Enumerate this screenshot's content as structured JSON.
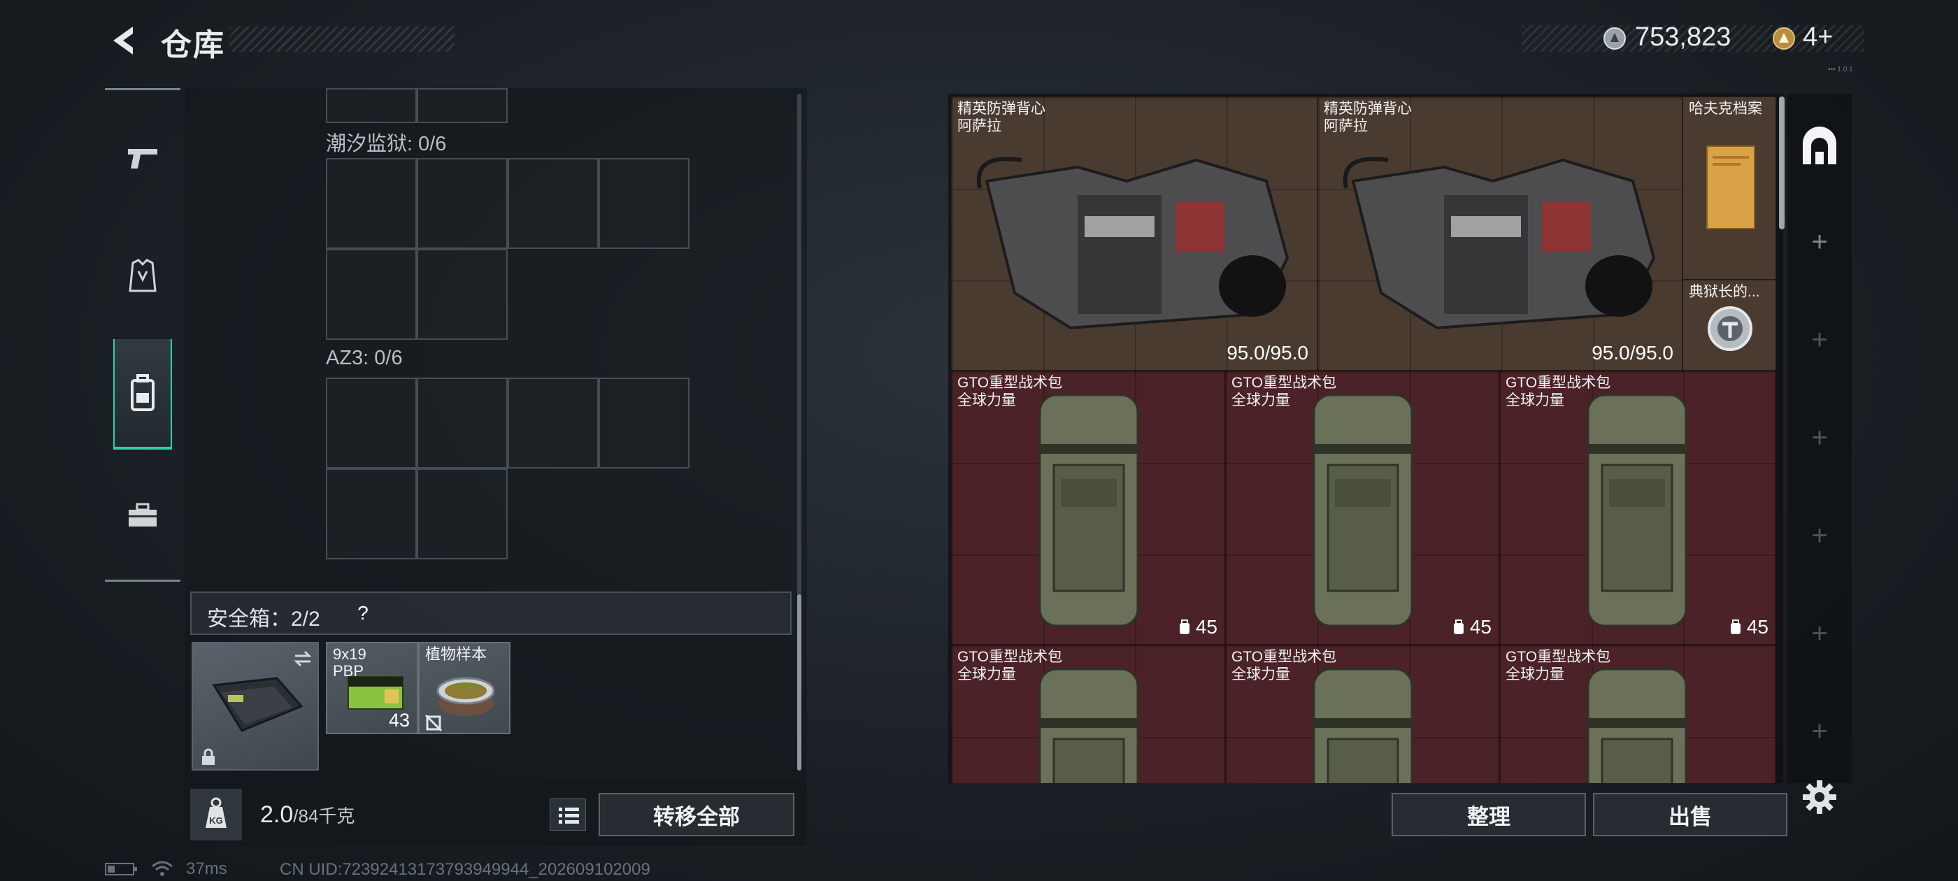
{
  "header": {
    "title": "仓库",
    "coin_value": "753,823",
    "premium_value": "4+",
    "version": "▪▪▪ 1.0.1"
  },
  "left": {
    "sections": [
      {
        "label": "潮汐监狱: 0/6"
      },
      {
        "label": "AZ3: 0/6"
      }
    ],
    "safebox": {
      "label": "安全箱：2/2",
      "help": "?"
    },
    "safebox_items": [
      {
        "name": "9x19\nPBP",
        "count": "43"
      },
      {
        "name": "植物样本",
        "count": ""
      }
    ],
    "weight": {
      "value": "2.0",
      "max": "/84千克",
      "kg_icon_text": "KG"
    },
    "transfer_all_label": "转移全部"
  },
  "stash": {
    "items": [
      {
        "name": "精英防弹背心\n阿萨拉",
        "durability": "95.0/95.0"
      },
      {
        "name": "精英防弹背心\n阿萨拉",
        "durability": "95.0/95.0"
      },
      {
        "name": "哈夫克档案"
      },
      {
        "name": "典狱长的..."
      },
      {
        "name": "GTO重型战术包\n全球力量",
        "capacity": "45"
      },
      {
        "name": "GTO重型战术包\n全球力量",
        "capacity": "45"
      },
      {
        "name": "GTO重型战术包\n全球力量",
        "capacity": "45"
      },
      {
        "name": "GTO重型战术包\n全球力量"
      },
      {
        "name": "GTO重型战术包\n全球力量"
      },
      {
        "name": "GTO重型战术包\n全球力量"
      }
    ],
    "sort_label": "整理",
    "sell_label": "出售"
  },
  "status": {
    "ping": "37ms",
    "uid": "CN UID:72392413173793949944_202609102009"
  },
  "colors": {
    "accent": "#2ad4a6",
    "brown_bg": "#4a3b30",
    "red_bg": "#4a2227"
  },
  "icons": [
    "back-arrow-icon",
    "coin-icon",
    "premium-coin-icon",
    "pistol-icon",
    "armor-vest-icon",
    "backpack-icon",
    "toolbox-icon",
    "lock-icon",
    "swap-icon",
    "no-trade-icon",
    "weight-icon",
    "list-icon",
    "stash-icon",
    "plus-icon",
    "gear-icon",
    "battery-icon",
    "wifi-icon"
  ]
}
